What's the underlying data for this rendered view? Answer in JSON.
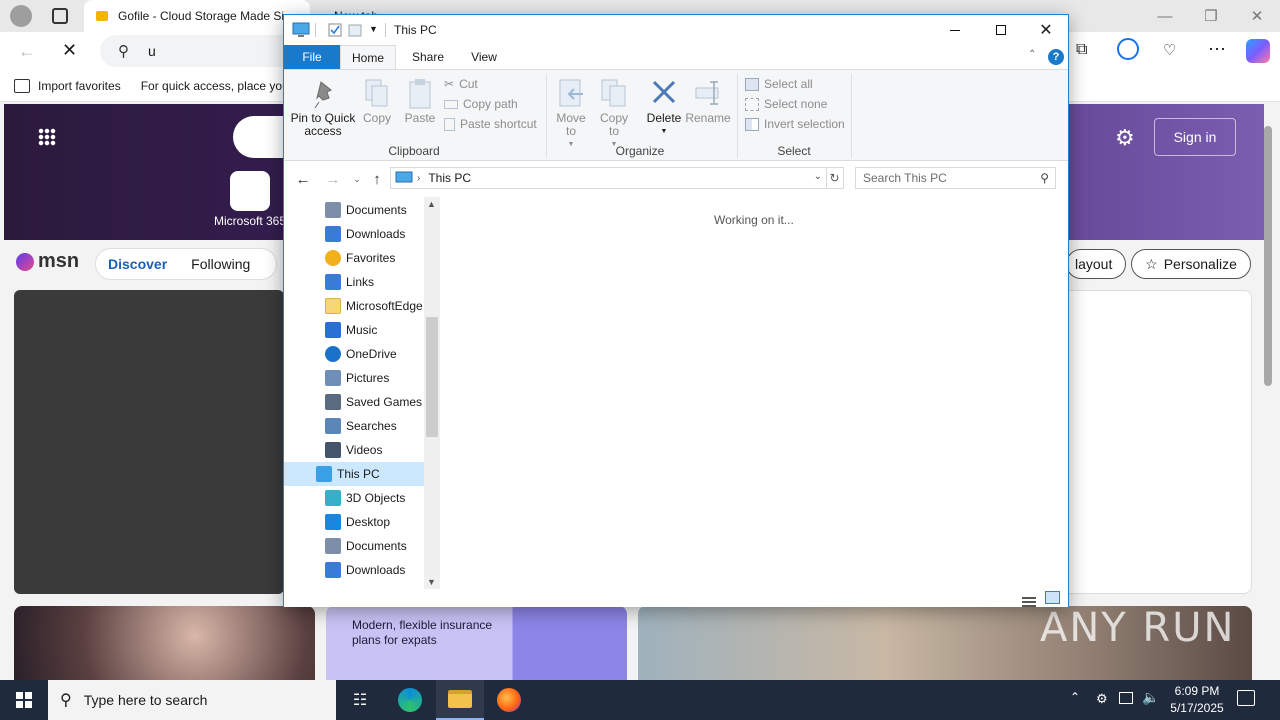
{
  "browser": {
    "tabs": [
      {
        "label": "Gofile - Cloud Storage Made Si"
      },
      {
        "label": "New tab"
      }
    ],
    "address_value": "u",
    "favorites": {
      "import_label": "Import favorites",
      "hint": "For quick access, place you"
    },
    "msn": {
      "app_label": "Microsoft 365",
      "logo": "msn",
      "discover": "Discover",
      "following": "Following",
      "sign_in": "Sign in",
      "layout": "layout",
      "personalize": "Personalize",
      "ad_text": "Modern, flexible insurance plans for expats"
    },
    "watermark": "ANY RUN"
  },
  "explorer": {
    "title": "This PC",
    "ribbon_tabs": [
      "File",
      "Home",
      "Share",
      "View"
    ],
    "clipboard": {
      "pin": "Pin to Quick access",
      "copy": "Copy",
      "paste": "Paste",
      "cut": "Cut",
      "copy_path": "Copy path",
      "paste_shortcut": "Paste shortcut",
      "label": "Clipboard"
    },
    "organize": {
      "move_to": "Move to",
      "copy_to": "Copy to",
      "delete": "Delete",
      "rename": "Rename",
      "label": "Organize"
    },
    "select": {
      "select_all": "Select all",
      "select_none": "Select none",
      "invert": "Invert selection",
      "label": "Select"
    },
    "address": "This PC",
    "search_placeholder": "Search This PC",
    "status": "Working on it...",
    "nav_items": [
      {
        "label": "Documents",
        "icon": "documents-icon"
      },
      {
        "label": "Downloads",
        "icon": "downloads-icon"
      },
      {
        "label": "Favorites",
        "icon": "favorites-icon"
      },
      {
        "label": "Links",
        "icon": "links-icon"
      },
      {
        "label": "MicrosoftEdge",
        "icon": "folder-icon"
      },
      {
        "label": "Music",
        "icon": "music-icon"
      },
      {
        "label": "OneDrive",
        "icon": "onedrive-icon"
      },
      {
        "label": "Pictures",
        "icon": "pictures-icon"
      },
      {
        "label": "Saved Games",
        "icon": "saved-games-icon"
      },
      {
        "label": "Searches",
        "icon": "searches-icon"
      },
      {
        "label": "Videos",
        "icon": "videos-icon"
      },
      {
        "label": "This PC",
        "icon": "this-pc-icon"
      },
      {
        "label": "3D Objects",
        "icon": "3d-objects-icon"
      },
      {
        "label": "Desktop",
        "icon": "desktop-icon"
      },
      {
        "label": "Documents",
        "icon": "documents-icon"
      },
      {
        "label": "Downloads",
        "icon": "downloads-icon"
      }
    ]
  },
  "taskbar": {
    "search_placeholder": "Type here to search",
    "time": "6:09 PM",
    "date": "5/17/2025"
  },
  "colors": {
    "accent": "#1979ca",
    "selected": "#cce8ff",
    "taskbar": "#1f2a3d"
  }
}
